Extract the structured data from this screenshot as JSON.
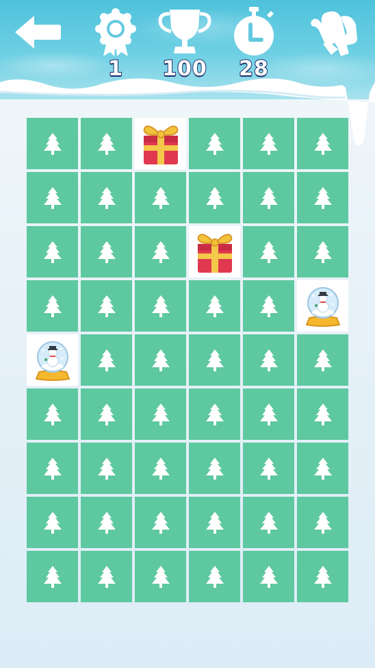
{
  "hud": {
    "back_icon": "back-arrow-icon",
    "level_icon": "rosette-badge-icon",
    "level_value": "1",
    "score_icon": "trophy-icon",
    "score_value": "100",
    "timer_icon": "stopwatch-icon",
    "timer_value": "28",
    "hint_icon": "mittens-icon"
  },
  "board": {
    "rows": 9,
    "cols": 6,
    "tiles": [
      [
        "tree",
        "tree",
        "gift",
        "tree",
        "tree",
        "tree"
      ],
      [
        "tree",
        "tree",
        "tree",
        "tree",
        "tree",
        "tree"
      ],
      [
        "tree",
        "tree",
        "tree",
        "gift",
        "tree",
        "tree"
      ],
      [
        "tree",
        "tree",
        "tree",
        "tree",
        "tree",
        "snowglobe"
      ],
      [
        "snowglobe",
        "tree",
        "tree",
        "tree",
        "tree",
        "tree"
      ],
      [
        "tree",
        "tree",
        "tree",
        "tree",
        "tree",
        "tree"
      ],
      [
        "tree",
        "tree",
        "tree",
        "tree",
        "tree",
        "tree"
      ],
      [
        "tree",
        "tree",
        "tree",
        "tree",
        "tree",
        "tree"
      ],
      [
        "tree",
        "tree",
        "tree",
        "tree",
        "tree",
        "tree"
      ]
    ]
  },
  "colors": {
    "tile_hidden": "#5ec8a0",
    "tile_revealed": "#ffffff",
    "header_top": "#4fc2dc",
    "hud_text_outline": "#1c2d6b"
  }
}
